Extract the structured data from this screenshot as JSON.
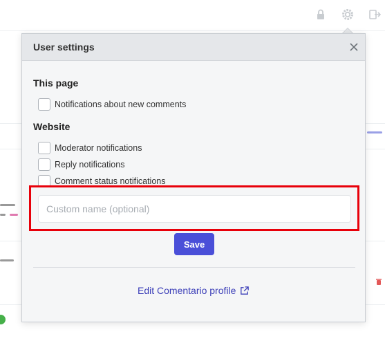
{
  "dialog": {
    "title": "User settings",
    "sections": {
      "this_page": {
        "title": "This page",
        "options": [
          "Notifications about new comments"
        ]
      },
      "website": {
        "title": "Website",
        "options": [
          "Moderator notifications",
          "Reply notifications",
          "Comment status notifications"
        ]
      }
    },
    "custom_name": {
      "value": "",
      "placeholder": "Custom name (optional)"
    },
    "save_label": "Save",
    "profile_link": "Edit Comentario profile"
  },
  "icons": {
    "close": "close-icon",
    "external": "external-link-icon",
    "lock": "lock-icon",
    "gear": "gear-icon",
    "logout": "logout-icon"
  },
  "colors": {
    "accent": "#4a4fd8",
    "highlight": "#e8000a",
    "link": "#3c3fb8"
  }
}
